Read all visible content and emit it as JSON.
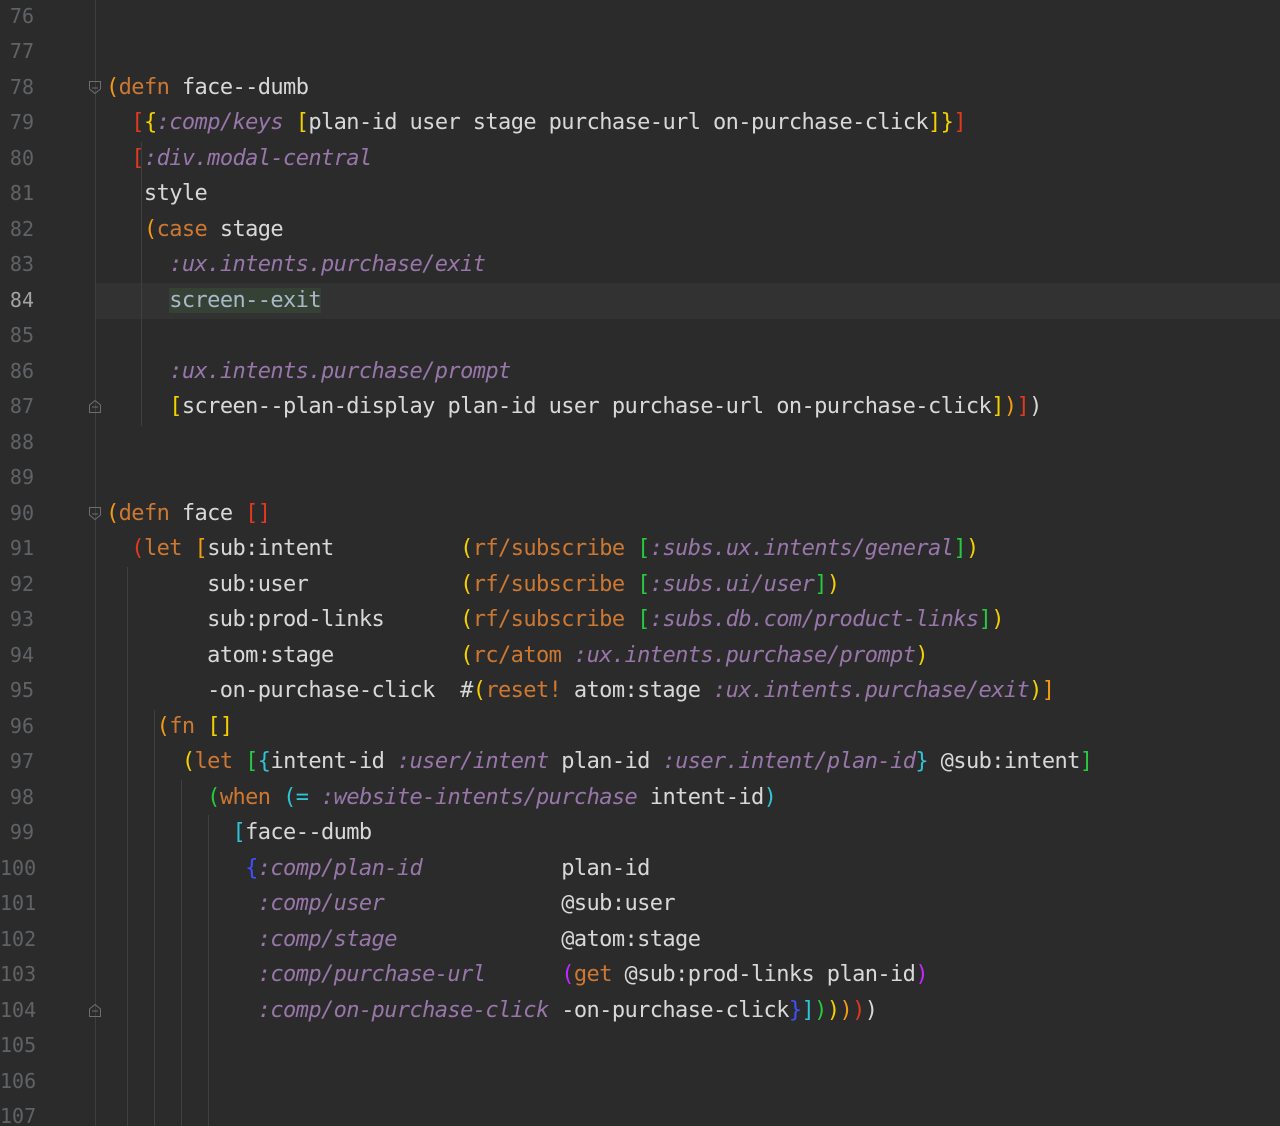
{
  "editor": {
    "current_line": "84",
    "lines": [
      {
        "n": "76",
        "tokens": []
      },
      {
        "n": "77",
        "tokens": []
      },
      {
        "n": "78",
        "fold": "open",
        "tokens": [
          [
            "p-orange",
            "("
          ],
          [
            "kw",
            "defn"
          ],
          [
            "sym",
            " face--dumb"
          ]
        ]
      },
      {
        "n": "79",
        "tokens": [
          [
            "sym",
            "  "
          ],
          [
            "p-red",
            "["
          ],
          [
            "p-yellow",
            "{"
          ],
          [
            "kwd",
            ":comp/keys"
          ],
          [
            "sym",
            " "
          ],
          [
            "p-yellow",
            "["
          ],
          [
            "sym",
            "plan-id user stage purchase-url on-purchase-click"
          ],
          [
            "p-yellow",
            "]"
          ],
          [
            "p-yellow",
            "}"
          ],
          [
            "p-red",
            "]"
          ]
        ]
      },
      {
        "n": "80",
        "tokens": [
          [
            "sym",
            "  "
          ],
          [
            "p-red",
            "["
          ],
          [
            "kwd",
            ":div.modal-central"
          ]
        ]
      },
      {
        "n": "81",
        "tokens": [
          [
            "sym",
            "   style"
          ]
        ]
      },
      {
        "n": "82",
        "tokens": [
          [
            "sym",
            "   "
          ],
          [
            "p-orange",
            "("
          ],
          [
            "kw",
            "case"
          ],
          [
            "sym",
            " stage"
          ]
        ]
      },
      {
        "n": "83",
        "tokens": [
          [
            "sym",
            "     "
          ],
          [
            "kwd",
            ":ux.intents.purchase/exit"
          ]
        ]
      },
      {
        "n": "84",
        "tokens": [
          [
            "sym",
            "     "
          ],
          [
            "hl",
            "screen--exit"
          ]
        ]
      },
      {
        "n": "85",
        "tokens": []
      },
      {
        "n": "86",
        "tokens": [
          [
            "sym",
            "     "
          ],
          [
            "kwd",
            ":ux.intents.purchase/prompt"
          ]
        ]
      },
      {
        "n": "87",
        "fold": "close",
        "tokens": [
          [
            "sym",
            "     "
          ],
          [
            "p-yellow",
            "["
          ],
          [
            "sym",
            "screen--plan-display plan-id user purchase-url on-purchase-click"
          ],
          [
            "p-yellow",
            "]"
          ],
          [
            "p-orange",
            ")"
          ],
          [
            "p-red",
            "]"
          ],
          [
            "sym",
            ")"
          ]
        ]
      },
      {
        "n": "88",
        "tokens": []
      },
      {
        "n": "89",
        "tokens": []
      },
      {
        "n": "90",
        "fold": "open",
        "tokens": [
          [
            "p-orange",
            "("
          ],
          [
            "kw",
            "defn"
          ],
          [
            "sym",
            " face "
          ],
          [
            "p-red",
            "[]"
          ]
        ]
      },
      {
        "n": "91",
        "tokens": [
          [
            "sym",
            "  "
          ],
          [
            "p-red",
            "("
          ],
          [
            "kw",
            "let"
          ],
          [
            "sym",
            " "
          ],
          [
            "p-orange",
            "["
          ],
          [
            "sym",
            "sub:intent          "
          ],
          [
            "p-yellow",
            "("
          ],
          [
            "kw",
            "rf/subscribe"
          ],
          [
            "sym",
            " "
          ],
          [
            "p-green",
            "["
          ],
          [
            "kwd",
            ":subs.ux.intents/general"
          ],
          [
            "p-green",
            "]"
          ],
          [
            "p-yellow",
            ")"
          ]
        ]
      },
      {
        "n": "92",
        "tokens": [
          [
            "sym",
            "        sub:user            "
          ],
          [
            "p-yellow",
            "("
          ],
          [
            "kw",
            "rf/subscribe"
          ],
          [
            "sym",
            " "
          ],
          [
            "p-green",
            "["
          ],
          [
            "kwd",
            ":subs.ui/user"
          ],
          [
            "p-green",
            "]"
          ],
          [
            "p-yellow",
            ")"
          ]
        ]
      },
      {
        "n": "93",
        "tokens": [
          [
            "sym",
            "        sub:prod-links      "
          ],
          [
            "p-yellow",
            "("
          ],
          [
            "kw",
            "rf/subscribe"
          ],
          [
            "sym",
            " "
          ],
          [
            "p-green",
            "["
          ],
          [
            "kwd",
            ":subs.db.com/product-links"
          ],
          [
            "p-green",
            "]"
          ],
          [
            "p-yellow",
            ")"
          ]
        ]
      },
      {
        "n": "94",
        "tokens": [
          [
            "sym",
            "        atom:stage          "
          ],
          [
            "p-yellow",
            "("
          ],
          [
            "kw",
            "rc/atom"
          ],
          [
            "sym",
            " "
          ],
          [
            "kwd",
            ":ux.intents.purchase/prompt"
          ],
          [
            "p-yellow",
            ")"
          ]
        ]
      },
      {
        "n": "95",
        "tokens": [
          [
            "sym",
            "        -on-purchase-click  #"
          ],
          [
            "p-yellow",
            "("
          ],
          [
            "kw",
            "reset!"
          ],
          [
            "sym",
            " atom:stage "
          ],
          [
            "kwd",
            ":ux.intents.purchase/exit"
          ],
          [
            "p-yellow",
            ")"
          ],
          [
            "p-orange",
            "]"
          ]
        ]
      },
      {
        "n": "96",
        "tokens": [
          [
            "sym",
            "    "
          ],
          [
            "p-orange",
            "("
          ],
          [
            "kw",
            "fn"
          ],
          [
            "sym",
            " "
          ],
          [
            "p-yellow",
            "[]"
          ]
        ]
      },
      {
        "n": "97",
        "tokens": [
          [
            "sym",
            "      "
          ],
          [
            "p-yellow",
            "("
          ],
          [
            "kw",
            "let"
          ],
          [
            "sym",
            " "
          ],
          [
            "p-green",
            "["
          ],
          [
            "p-cyan",
            "{"
          ],
          [
            "sym",
            "intent-id "
          ],
          [
            "kwd",
            ":user/intent"
          ],
          [
            "sym",
            " plan-id "
          ],
          [
            "kwd",
            ":user.intent/plan-id"
          ],
          [
            "p-cyan",
            "}"
          ],
          [
            "sym",
            " @sub:intent"
          ],
          [
            "p-green",
            "]"
          ]
        ]
      },
      {
        "n": "98",
        "tokens": [
          [
            "sym",
            "        "
          ],
          [
            "p-green",
            "("
          ],
          [
            "kw",
            "when"
          ],
          [
            "sym",
            " "
          ],
          [
            "p-cyan",
            "(="
          ],
          [
            "sym",
            " "
          ],
          [
            "kwd",
            ":website-intents/purchase"
          ],
          [
            "sym",
            " intent-id"
          ],
          [
            "p-cyan",
            ")"
          ]
        ]
      },
      {
        "n": "99",
        "tokens": [
          [
            "sym",
            "          "
          ],
          [
            "p-cyan",
            "["
          ],
          [
            "sym",
            "face--dumb"
          ]
        ]
      },
      {
        "n": "100",
        "tokens": [
          [
            "sym",
            "           "
          ],
          [
            "p-blue",
            "{"
          ],
          [
            "kwd",
            ":comp/plan-id"
          ],
          [
            "sym",
            "           plan-id"
          ]
        ]
      },
      {
        "n": "101",
        "tokens": [
          [
            "sym",
            "            "
          ],
          [
            "kwd",
            ":comp/user"
          ],
          [
            "sym",
            "              @sub:user"
          ]
        ]
      },
      {
        "n": "102",
        "tokens": [
          [
            "sym",
            "            "
          ],
          [
            "kwd",
            ":comp/stage"
          ],
          [
            "sym",
            "             @atom:stage"
          ]
        ]
      },
      {
        "n": "103",
        "tokens": [
          [
            "sym",
            "            "
          ],
          [
            "kwd",
            ":comp/purchase-url"
          ],
          [
            "sym",
            "      "
          ],
          [
            "p-purple",
            "("
          ],
          [
            "kw",
            "get"
          ],
          [
            "sym",
            " @sub:prod-links plan-id"
          ],
          [
            "p-purple",
            ")"
          ]
        ]
      },
      {
        "n": "104",
        "fold": "close",
        "tokens": [
          [
            "sym",
            "            "
          ],
          [
            "kwd",
            ":comp/on-purchase-click"
          ],
          [
            "sym",
            " -on-purchase-click"
          ],
          [
            "p-blue",
            "}"
          ],
          [
            "p-cyan",
            "]"
          ],
          [
            "p-green",
            ")"
          ],
          [
            "p-yellow",
            ")"
          ],
          [
            "p-orange",
            ")"
          ],
          [
            "p-red",
            ")"
          ],
          [
            "sym",
            ")"
          ]
        ]
      },
      {
        "n": "105",
        "tokens": []
      },
      {
        "n": "106",
        "tokens": []
      },
      {
        "n": "107",
        "tokens": []
      }
    ]
  }
}
